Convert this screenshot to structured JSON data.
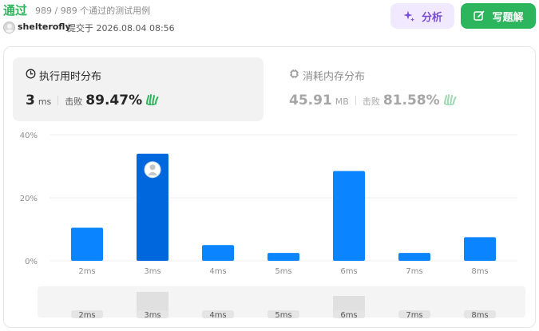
{
  "header": {
    "status": "通过",
    "count": "989 / 989 个通过的测试用例",
    "username": "shelterofly",
    "submitted": "提交于 2026.08.04 08:56",
    "analyze_label": "分析",
    "solution_label": "写题解"
  },
  "colors": {
    "accent_green": "#2db55d",
    "bar_blue": "#0a84ff",
    "bar_blue_selected": "#0067dd",
    "analyze_purple": "#7a4cd9"
  },
  "stats": {
    "runtime": {
      "title": "执行用时分布",
      "value": "3",
      "unit": "ms",
      "beat_label": "击败",
      "beat_pct": "89.47%"
    },
    "memory": {
      "title": "消耗内存分布",
      "value": "45.91",
      "unit": "MB",
      "beat_label": "击败",
      "beat_pct": "81.58%"
    }
  },
  "chart_data": {
    "type": "bar",
    "categories": [
      "2ms",
      "3ms",
      "4ms",
      "5ms",
      "6ms",
      "7ms",
      "8ms"
    ],
    "values": [
      10.5,
      34,
      5,
      2.5,
      28.5,
      2.5,
      7.5
    ],
    "yticks": [
      "0%",
      "20%",
      "40%"
    ],
    "ylim": [
      0,
      40
    ],
    "selected": "3ms",
    "grid": true
  },
  "overview": {
    "labels": [
      "2ms",
      "3ms",
      "4ms",
      "5ms",
      "6ms",
      "7ms",
      "8ms"
    ],
    "highlighted": [
      "3ms",
      "6ms"
    ]
  }
}
